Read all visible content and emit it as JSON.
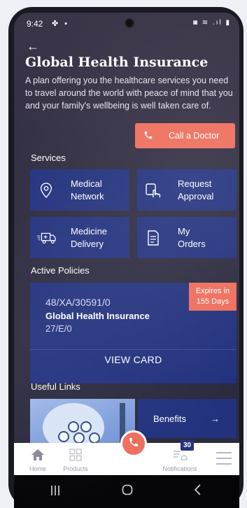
{
  "status_bar": {
    "time": "9:42",
    "left_icons": "✤ ▪",
    "right_icons": "◙ ≋ .ıl ▮"
  },
  "header": {
    "title": "Global Health Insurance",
    "subtitle": "A plan offering you the healthcare services you need to travel around the world with peace of mind that you and your family's wellbeing is well taken care of."
  },
  "call_button": {
    "label": "Call a Doctor"
  },
  "services": {
    "heading": "Services",
    "items": [
      {
        "line1": "Medical",
        "line2": "Network",
        "icon": "location-pin-icon"
      },
      {
        "line1": "Request",
        "line2": "Approval",
        "icon": "tap-hand-icon"
      },
      {
        "line1": "Medicine",
        "line2": "Delivery",
        "icon": "delivery-truck-icon"
      },
      {
        "line1": "My",
        "line2": "Orders",
        "icon": "document-icon"
      }
    ]
  },
  "active_policies": {
    "heading": "Active Policies",
    "policy": {
      "number": "48/XA/30591/0",
      "name": "Global Health Insurance",
      "code": "27/E/0",
      "expires_line1": "Expires in",
      "expires_line2": "155 Days",
      "view_card": "VIEW CARD"
    }
  },
  "useful_links": {
    "heading": "Useful Links",
    "benefits_label": "Benefits",
    "benefits_arrow": "→"
  },
  "bottom_nav": {
    "home": "Home",
    "products": "Products",
    "notifications": "Notifications",
    "notifications_count": "30"
  },
  "colors": {
    "accent": "#ee6e5c",
    "tile": "#23327e"
  }
}
